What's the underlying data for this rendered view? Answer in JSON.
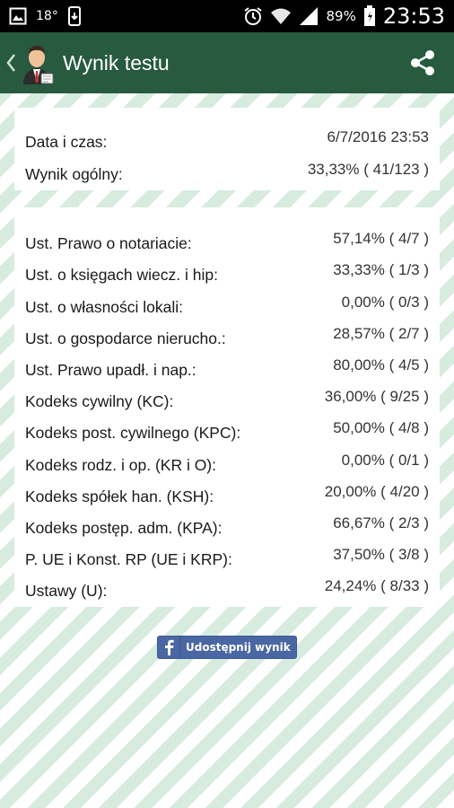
{
  "status_bar": {
    "temperature": "18°",
    "battery_percent": "89%",
    "time": "23:53",
    "icons": [
      "gallery-icon",
      "phone-download-icon",
      "alarm-icon",
      "wifi-icon",
      "signal-icon",
      "battery-icon"
    ]
  },
  "app_bar": {
    "title": "Wynik testu",
    "icons": [
      "back-icon",
      "app-logo-icon",
      "share-icon"
    ],
    "color": "#275a3f"
  },
  "summary": {
    "rows": [
      {
        "label": "Data i czas:",
        "value": "6/7/2016 23:53"
      },
      {
        "label": "Wynik ogólny:",
        "value": "33,33% ( 41/123 )"
      }
    ]
  },
  "results": {
    "rows": [
      {
        "label": "Ust. Prawo o notariacie:",
        "value": "57,14% ( 4/7 )"
      },
      {
        "label": "Ust. o księgach wiecz. i hip:",
        "value": "33,33% ( 1/3 )"
      },
      {
        "label": "Ust. o własności lokali:",
        "value": "0,00% ( 0/3 )"
      },
      {
        "label": "Ust. o gospodarce nierucho.:",
        "value": "28,57% ( 2/7 )"
      },
      {
        "label": "Ust. Prawo upadł. i nap.:",
        "value": "80,00% ( 4/5 )"
      },
      {
        "label": "Kodeks cywilny (KC):",
        "value": "36,00% ( 9/25 )"
      },
      {
        "label": "Kodeks post. cywilnego (KPC):",
        "value": "50,00% ( 4/8 )"
      },
      {
        "label": "Kodeks rodz. i op. (KR i O):",
        "value": "0,00% ( 0/1 )"
      },
      {
        "label": "Kodeks spółek han. (KSH):",
        "value": "20,00% ( 4/20 )"
      },
      {
        "label": "Kodeks postęp. adm. (KPA):",
        "value": "66,67% ( 2/3 )"
      },
      {
        "label": "P. UE i Konst. RP (UE i KRP):",
        "value": "37,50% ( 3/8 )"
      },
      {
        "label": "Ustawy (U):",
        "value": "24,24% ( 8/33 )"
      }
    ]
  },
  "facebook": {
    "label": "Udostępnij wynik",
    "icon": "facebook-icon",
    "color": "#4a67a3"
  }
}
